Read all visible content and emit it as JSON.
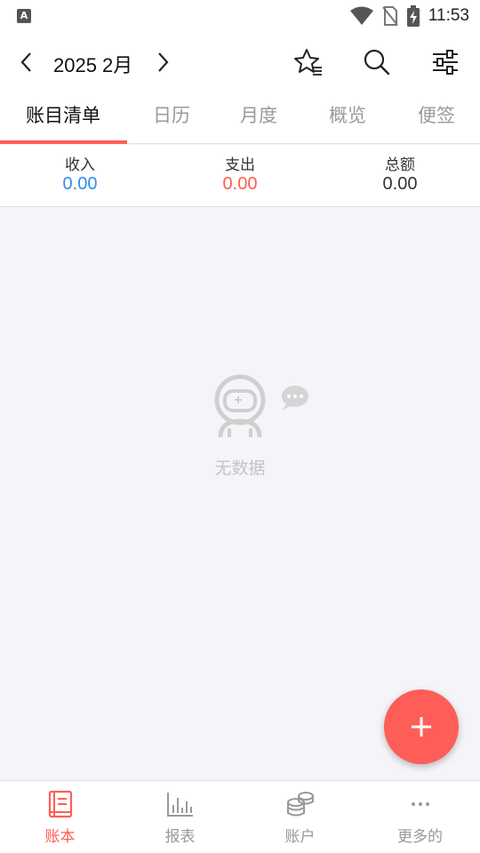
{
  "status_bar": {
    "app_badge": "A",
    "time": "11:53",
    "icons": [
      "wifi-icon",
      "no-sim-icon",
      "battery-charging-icon"
    ]
  },
  "header": {
    "title": "2025 2月",
    "prev_icon": "chevron-left-icon",
    "next_icon": "chevron-right-icon",
    "actions": [
      "favorite-list-icon",
      "search-icon",
      "filter-sliders-icon"
    ]
  },
  "tabs": [
    {
      "label": "账目清单",
      "active": true
    },
    {
      "label": "日历",
      "active": false
    },
    {
      "label": "月度",
      "active": false
    },
    {
      "label": "概览",
      "active": false
    },
    {
      "label": "便签",
      "active": false
    }
  ],
  "summary": {
    "income": {
      "label": "收入",
      "value": "0.00"
    },
    "expense": {
      "label": "支出",
      "value": "0.00"
    },
    "total": {
      "label": "总额",
      "value": "0.00"
    }
  },
  "empty_state": {
    "icon": "astronaut-icon",
    "text": "无数据"
  },
  "fab": {
    "icon": "plus-icon"
  },
  "bottom_nav": [
    {
      "label": "账本",
      "icon": "ledger-book-icon",
      "active": true
    },
    {
      "label": "报表",
      "icon": "bar-chart-icon",
      "active": false
    },
    {
      "label": "账户",
      "icon": "coins-stack-icon",
      "active": false
    },
    {
      "label": "更多的",
      "icon": "more-dots-icon",
      "active": false
    }
  ],
  "colors": {
    "accent": "#ff5d57",
    "income": "#2f8cf0",
    "expense": "#ff5d47",
    "total": "#333333",
    "background": "#f5f5f9"
  }
}
